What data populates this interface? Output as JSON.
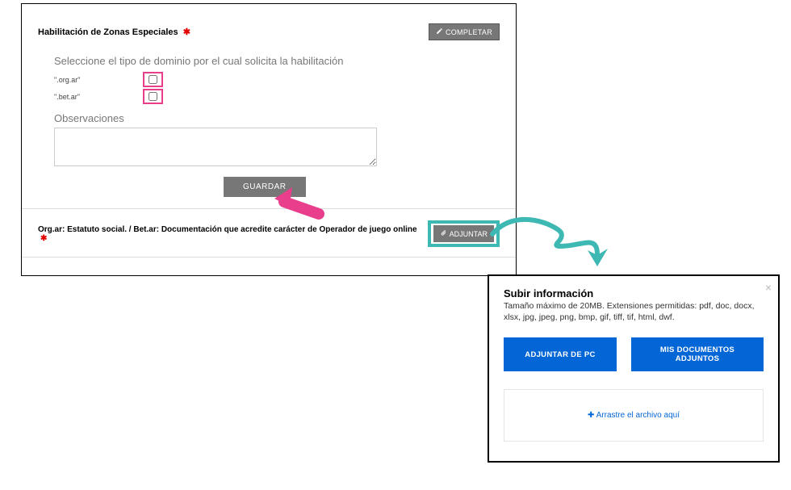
{
  "main": {
    "header": "Habilitación de Zonas Especiales",
    "completar_label": "COMPLETAR",
    "domain_section_title": "Seleccione el tipo de dominio por el cual solicita la habilitación",
    "domain_options": [
      {
        "label": "\".org.ar\""
      },
      {
        "label": "\".bet.ar\""
      }
    ],
    "observaciones_title": "Observaciones",
    "observaciones_value": "",
    "guardar_label": "GUARDAR",
    "attach_section_label": "Org.ar: Estatuto social. / Bet.ar: Documentación que acredite carácter de Operador de juego online",
    "adjuntar_label": "ADJUNTAR"
  },
  "modal": {
    "title": "Subir información",
    "subtitle": "Tamaño máximo de 20MB. Extensiones permitidas: pdf, doc, docx, xlsx, jpg, jpeg, png, bmp, gif, tiff, tif, html, dwf.",
    "btn_pc": "ADJUNTAR DE PC",
    "btn_mydocs": "MIS DOCUMENTOS ADJUNTOS",
    "drop_text": "Arrastre el archivo aquí"
  },
  "colors": {
    "highlight_pink": "#e83e8c",
    "highlight_teal": "#3eb8b3",
    "btn_blue": "#0366d6",
    "btn_grey": "#777"
  }
}
